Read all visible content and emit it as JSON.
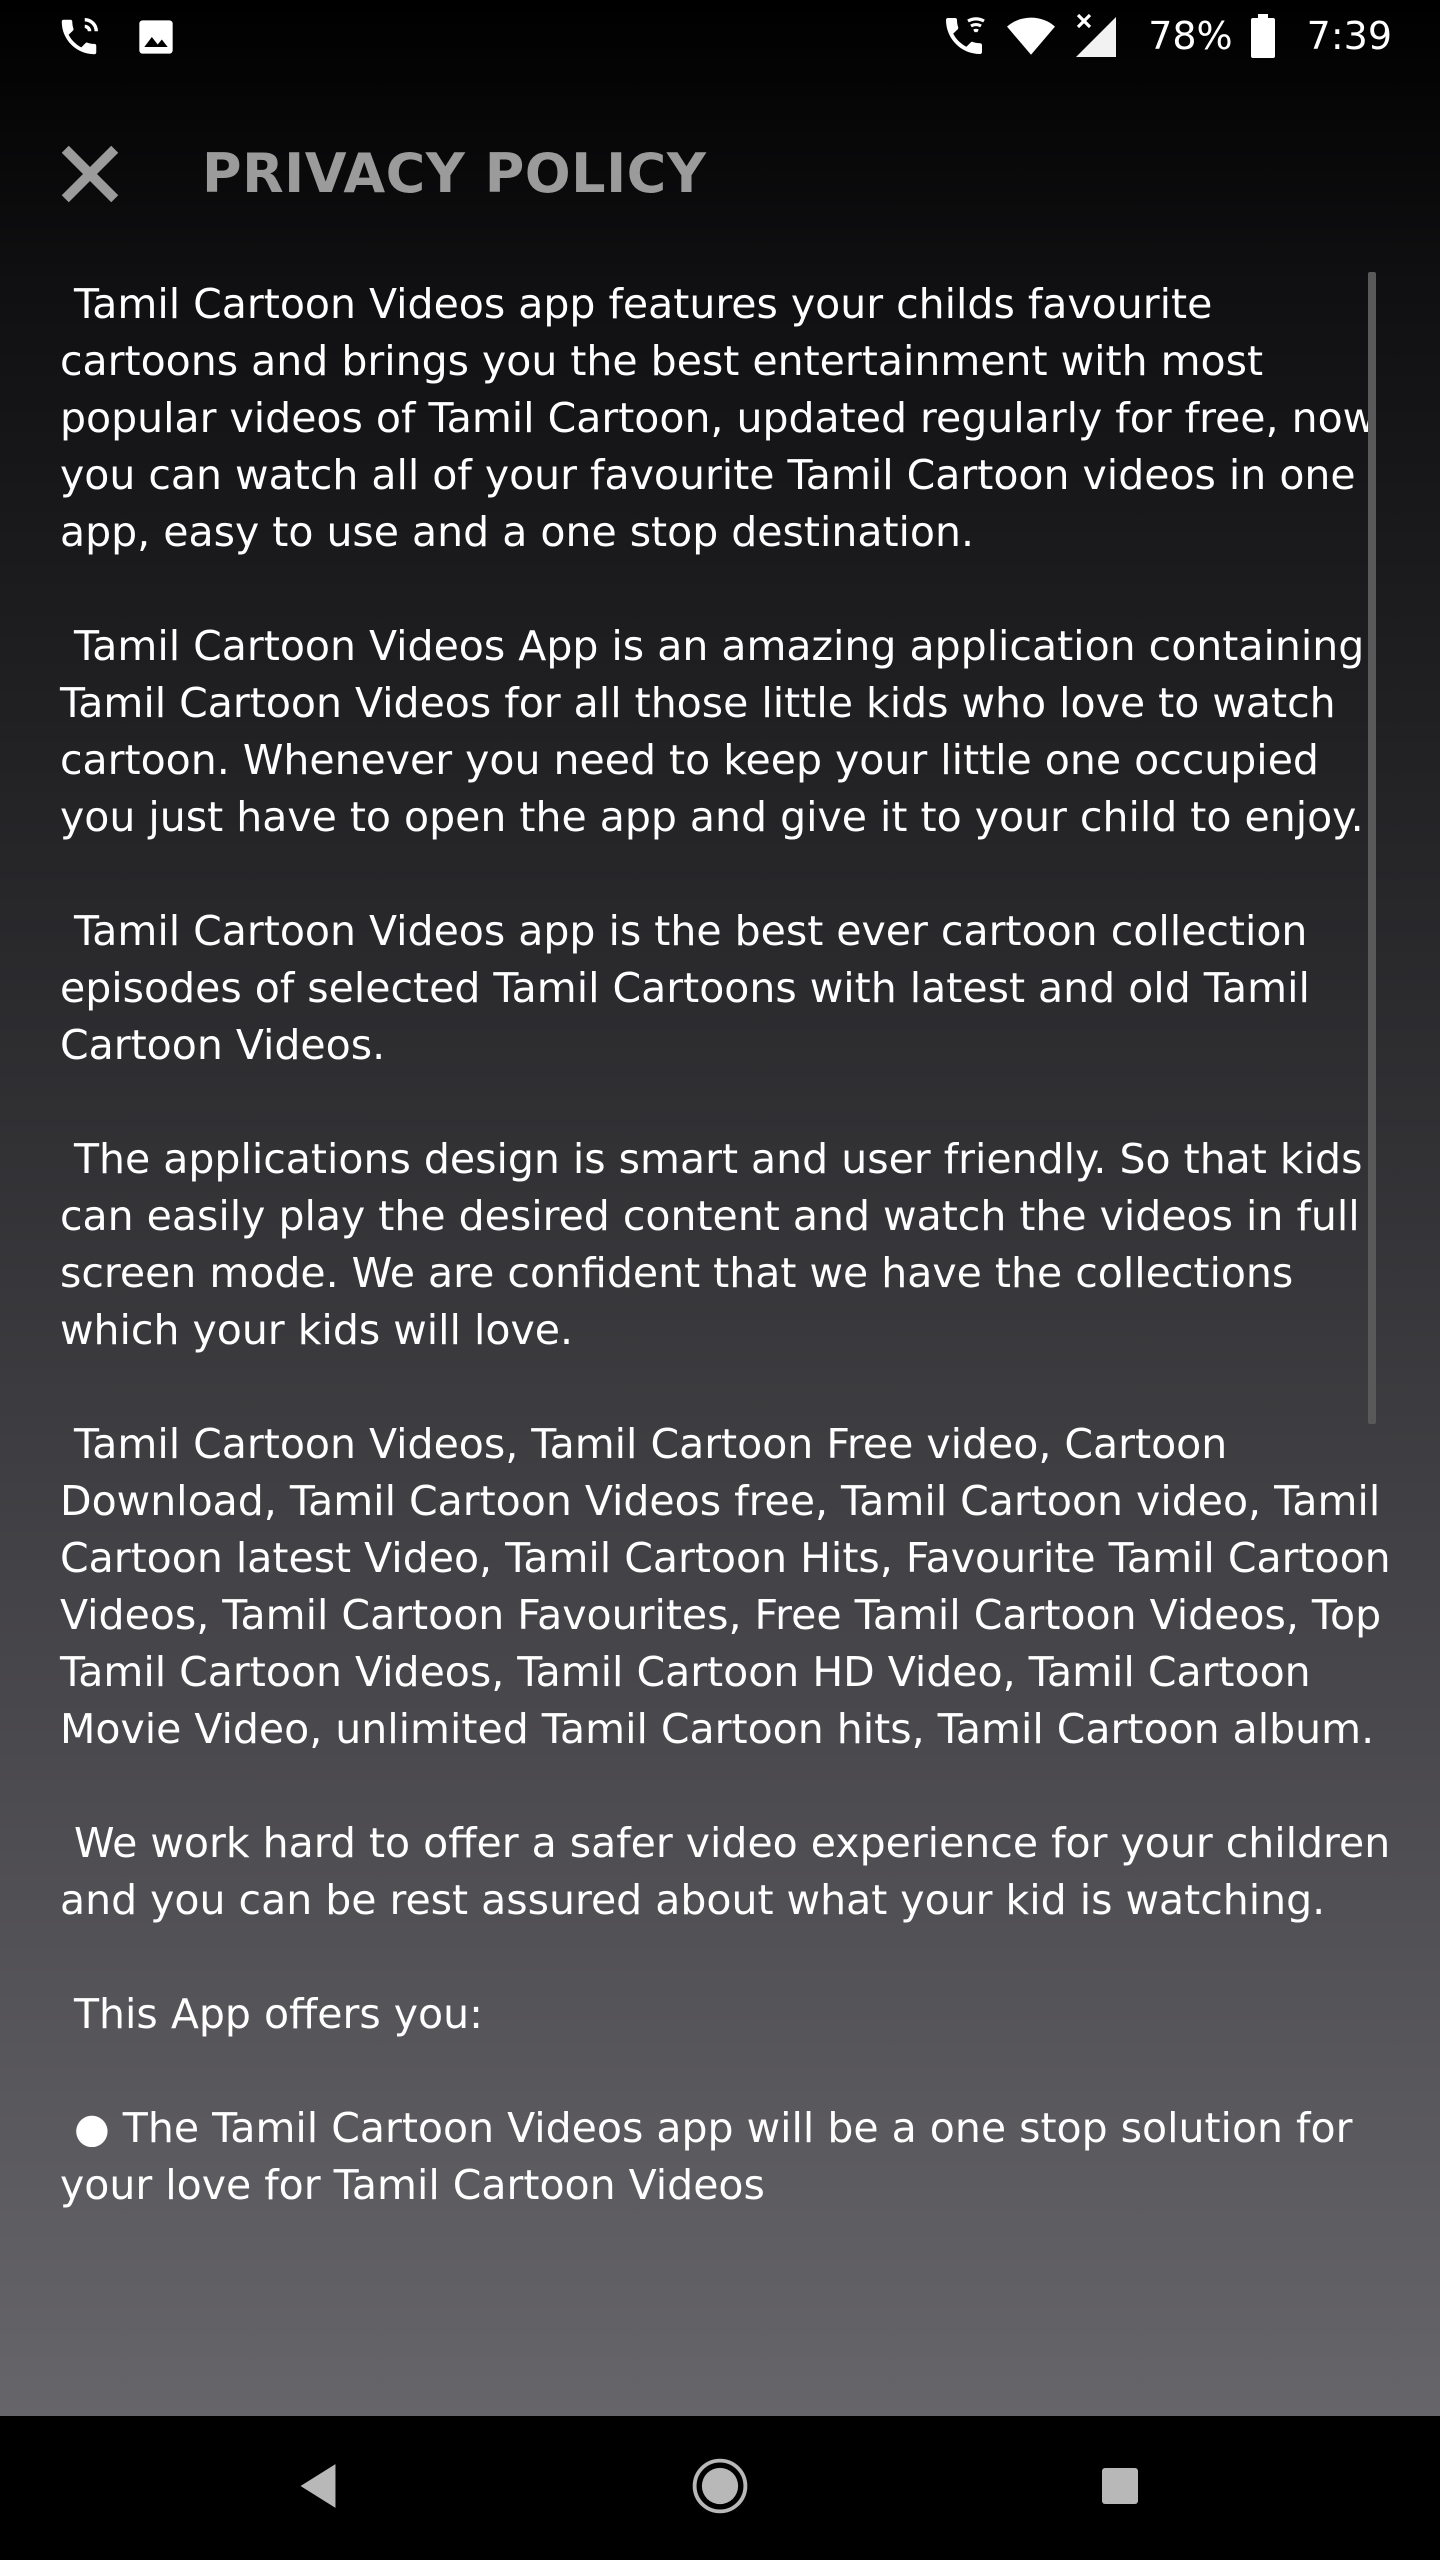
{
  "status_bar": {
    "battery_percent": "78%",
    "time": "7:39",
    "icons": [
      "phone-call-icon",
      "image-icon",
      "wifi-calling-icon",
      "wifi-icon",
      "signal-icon",
      "battery-icon"
    ]
  },
  "header": {
    "title": "PRIVACY POLICY",
    "close_icon": "close-icon"
  },
  "content": {
    "paragraphs": [
      "Tamil Cartoon Videos app features your childs favourite cartoons and brings you the best entertainment with most popular videos of Tamil Cartoon, updated regularly for free, now you can watch all of your favourite Tamil Cartoon videos in one app, easy to use and a one stop destination.",
      "Tamil Cartoon Videos App is an amazing application containing Tamil Cartoon Videos for all those little kids who love to watch cartoon. Whenever you need to keep your little one occupied you just have to open the app and give it to your child to enjoy.",
      "Tamil Cartoon Videos app is the best ever cartoon collection episodes of selected Tamil Cartoons with latest and old Tamil Cartoon Videos.",
      "The applications design is smart and user friendly. So that kids can easily play the desired content and watch the videos in full screen mode. We are confident that we have the collections which your kids will love.",
      "Tamil Cartoon Videos, Tamil Cartoon Free video, Cartoon Download, Tamil Cartoon Videos free, Tamil Cartoon video, Tamil Cartoon latest Video, Tamil Cartoon Hits, Favourite Tamil Cartoon Videos, Tamil Cartoon Favourites, Free Tamil Cartoon Videos, Top Tamil Cartoon Videos, Tamil Cartoon HD Video, Tamil Cartoon Movie Video, unlimited Tamil Cartoon hits, Tamil Cartoon album.",
      "We work hard to offer a safer video experience for your children and you can be rest assured about what your kid is watching.",
      "This App offers you:",
      "● The Tamil Cartoon Videos app will be a one stop solution for your love for Tamil Cartoon Videos"
    ]
  },
  "nav_bar": {
    "icons": [
      "back-icon",
      "home-icon",
      "recents-icon"
    ]
  },
  "colors": {
    "title": "#9b9b9b",
    "text": "#ffffff",
    "scrollbar": "#595959",
    "nav_bg": "#000000"
  }
}
